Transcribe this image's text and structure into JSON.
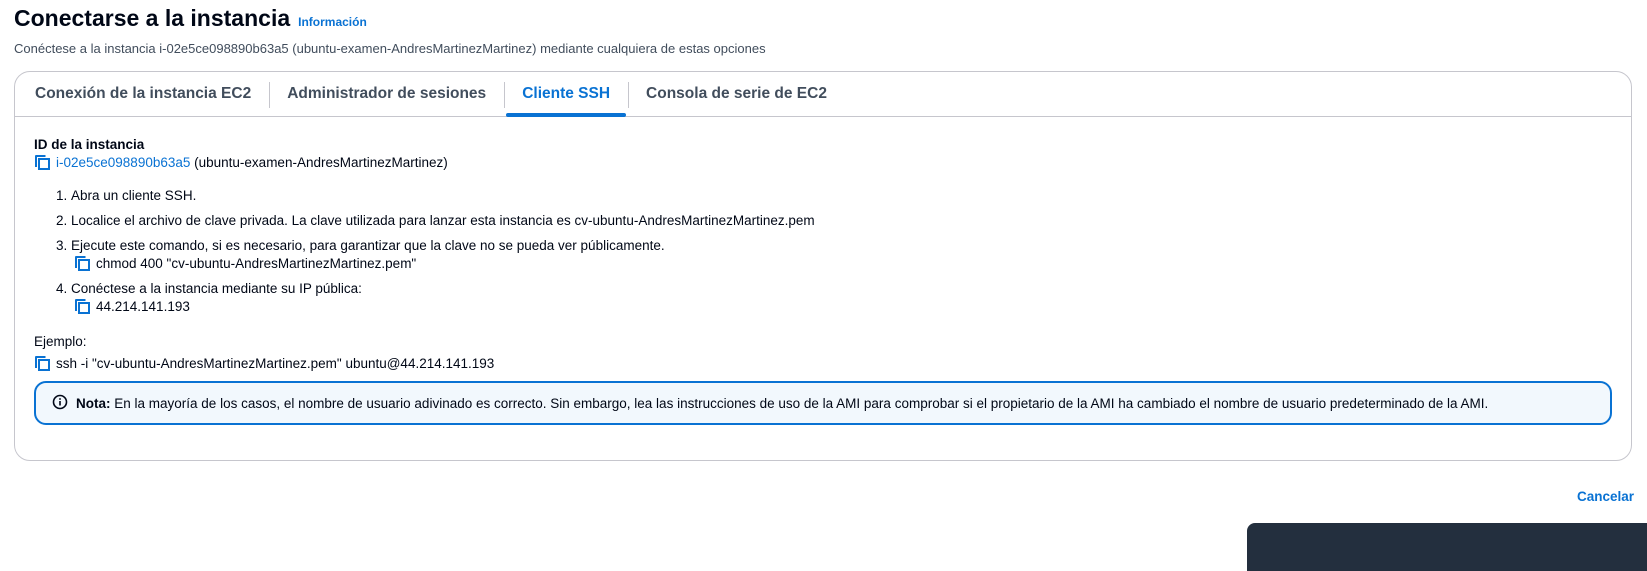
{
  "header": {
    "title": "Conectarse a la instancia",
    "info_link": "Información",
    "subtitle": "Conéctese a la instancia i-02e5ce098890b63a5 (ubuntu-examen-AndresMartinezMartinez) mediante cualquiera de estas opciones"
  },
  "tabs": [
    {
      "label": "Conexión de la instancia EC2",
      "active": false
    },
    {
      "label": "Administrador de sesiones",
      "active": false
    },
    {
      "label": "Cliente SSH",
      "active": true
    },
    {
      "label": "Consola de serie de EC2",
      "active": false
    }
  ],
  "instance": {
    "label": "ID de la instancia",
    "id": "i-02e5ce098890b63a5",
    "name": "(ubuntu-examen-AndresMartinezMartinez)"
  },
  "steps": [
    {
      "text": "Abra un cliente SSH."
    },
    {
      "text": "Localice el archivo de clave privada. La clave utilizada para lanzar esta instancia es cv-ubuntu-AndresMartinezMartinez.pem"
    },
    {
      "text": "Ejecute este comando, si es necesario, para garantizar que la clave no se pueda ver públicamente.",
      "copy": "chmod 400 \"cv-ubuntu-AndresMartinezMartinez.pem\""
    },
    {
      "text": "Conéctese a la instancia mediante su IP pública:",
      "copy": "44.214.141.193"
    }
  ],
  "example": {
    "label": "Ejemplo:",
    "command": "ssh -i \"cv-ubuntu-AndresMartinezMartinez.pem\" ubuntu@44.214.141.193"
  },
  "alert": {
    "title": "Nota:",
    "text": "En la mayoría de los casos, el nombre de usuario adivinado es correcto. Sin embargo, lea las instrucciones de uso de la AMI para comprobar si el propietario de la AMI ha cambiado el nombre de usuario predeterminado de la AMI."
  },
  "footer": {
    "cancel": "Cancelar"
  },
  "colors": {
    "accent": "#0972d3",
    "alert_bg": "#f2f8fd",
    "border": "#c6c6cd"
  }
}
